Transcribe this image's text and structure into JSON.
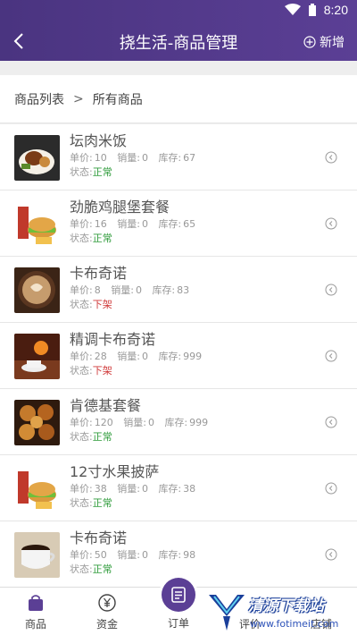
{
  "status_bar": {
    "time": "8:20"
  },
  "header": {
    "title": "挠生活-商品管理",
    "add_label": "新增"
  },
  "breadcrumb": {
    "root": "商品列表",
    "separator": ">",
    "current": "所有商品"
  },
  "labels": {
    "price": "单价:",
    "sales": "销量:",
    "stock": "库存:",
    "status": "状态:"
  },
  "products": [
    {
      "name": "坛肉米饭",
      "price": "10",
      "sales": "0",
      "stock": "67",
      "status": "正常",
      "status_kind": "on",
      "image": "rice-bowl"
    },
    {
      "name": "劲脆鸡腿堡套餐",
      "price": "16",
      "sales": "0",
      "stock": "65",
      "status": "正常",
      "status_kind": "on",
      "image": "burger-combo"
    },
    {
      "name": "卡布奇诺",
      "price": "8",
      "sales": "0",
      "stock": "83",
      "status": "下架",
      "status_kind": "off",
      "image": "latte-art"
    },
    {
      "name": "精调卡布奇诺",
      "price": "28",
      "sales": "0",
      "stock": "999",
      "status": "下架",
      "status_kind": "off",
      "image": "coffee-fireplace"
    },
    {
      "name": "肯德基套餐",
      "price": "120",
      "sales": "0",
      "stock": "999",
      "status": "正常",
      "status_kind": "on",
      "image": "fried-chicken"
    },
    {
      "name": "12寸水果披萨",
      "price": "38",
      "sales": "0",
      "stock": "38",
      "status": "正常",
      "status_kind": "on",
      "image": "burger-combo"
    },
    {
      "name": "卡布奇诺",
      "price": "50",
      "sales": "0",
      "stock": "98",
      "status": "正常",
      "status_kind": "on",
      "image": "coffee-cup"
    }
  ],
  "tabbar": {
    "goods": "商品",
    "funds": "资金",
    "orders": "订单",
    "reviews": "评价",
    "shop": "店铺"
  },
  "watermark": {
    "text": "清源下载站",
    "url": "www.fotimeit.com"
  },
  "colors": {
    "accent": "#5b3f95",
    "status_on": "#2e9b3a",
    "status_off": "#d03a3a"
  }
}
